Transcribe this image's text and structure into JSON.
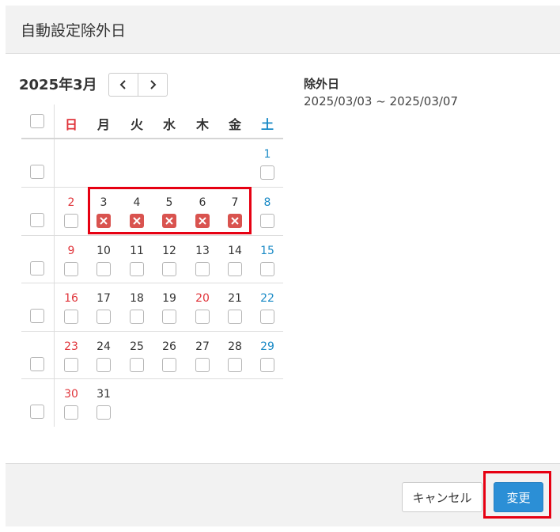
{
  "dialog": {
    "title": "自動設定除外日",
    "cancel_label": "キャンセル",
    "submit_label": "変更"
  },
  "calendar": {
    "month_label": "2025年3月",
    "prev_icon": "chevron-left-icon",
    "next_icon": "chevron-right-icon",
    "weekdays": [
      "日",
      "月",
      "火",
      "水",
      "木",
      "金",
      "土"
    ],
    "weeks": [
      [
        "",
        "",
        "",
        "",
        "",
        "",
        "1"
      ],
      [
        "2",
        "3",
        "4",
        "5",
        "6",
        "7",
        "8"
      ],
      [
        "9",
        "10",
        "11",
        "12",
        "13",
        "14",
        "15"
      ],
      [
        "16",
        "17",
        "18",
        "19",
        "20",
        "21",
        "22"
      ],
      [
        "23",
        "24",
        "25",
        "26",
        "27",
        "28",
        "29"
      ],
      [
        "30",
        "31",
        "",
        "",
        "",
        "",
        ""
      ]
    ],
    "holidays": [
      "20"
    ],
    "excluded_days": [
      "3",
      "4",
      "5",
      "6",
      "7"
    ],
    "excluded_icon": "x-mark-icon"
  },
  "exclusion": {
    "title": "除外日",
    "range": "2025/03/03 ~ 2025/03/07"
  },
  "colors": {
    "sunday": "#e0343a",
    "saturday": "#1a8ac6",
    "excluded": "#d9534f",
    "primary": "#2b8fd6",
    "highlight": "#e60012"
  }
}
